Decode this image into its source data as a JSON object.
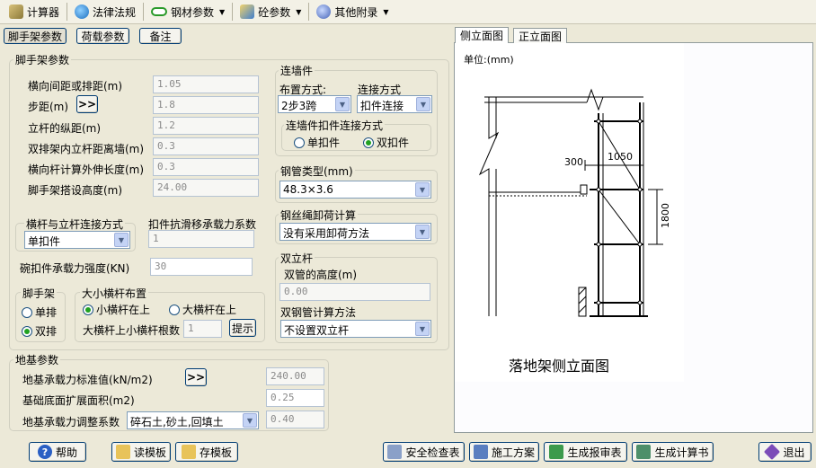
{
  "toolbar": {
    "items": [
      {
        "label": "计算器",
        "icon": "calculator-icon"
      },
      {
        "label": "法律法规",
        "icon": "globe-icon"
      },
      {
        "label": "钢材参数",
        "icon": "steel-icon"
      },
      {
        "label": "砼参数",
        "icon": "concrete-icon"
      },
      {
        "label": "其他附录",
        "icon": "appendix-icon"
      }
    ]
  },
  "top_tabs": {
    "scaffold": "脚手架参数",
    "load": "荷载参数",
    "note": "备注"
  },
  "scaffold": {
    "group_label": "脚手架参数",
    "rows": [
      {
        "label": "横向间距或排距(m)",
        "value": "1.05"
      },
      {
        "label": "步距(m)",
        "value": "1.8"
      },
      {
        "label": "立杆的纵距(m)",
        "value": "1.2"
      },
      {
        "label": "双排架内立杆距离墙(m)",
        "value": "0.3"
      },
      {
        "label": "横向杆计算外伸长度(m)",
        "value": "0.3"
      },
      {
        "label": "脚手架搭设高度(m)",
        "value": "24.00"
      }
    ],
    "step_button": ">>"
  },
  "connection": {
    "group_label": "横杆与立杆连接方式",
    "value": "单扣件",
    "slip_label": "扣件抗滑移承载力系数",
    "slip_value": "1",
    "bowl_label": "碗扣件承载力强度(KN)",
    "bowl_value": "30"
  },
  "frame": {
    "group_label": "脚手架",
    "single": "单排",
    "double": "双排",
    "selected": "double"
  },
  "crossbar": {
    "group_label": "大小横杆布置",
    "small_top": "小横杆在上",
    "big_top": "大横杆在上",
    "selected": "small_top",
    "count_label": "大横杆上小横杆根数",
    "count_value": "1",
    "hint_button": "提示"
  },
  "wall_tie": {
    "group_label": "连墙件",
    "layout_label": "布置方式:",
    "layout_value": "2步3跨",
    "connect_label": "连接方式",
    "connect_value": "扣件连接",
    "clamp_group": "连墙件扣件连接方式",
    "single": "单扣件",
    "double": "双扣件",
    "selected": "double"
  },
  "pipe": {
    "group_label": "钢管类型(mm)",
    "value": "48.3×3.6"
  },
  "wire": {
    "group_label": "钢丝绳卸荷计算",
    "value": "没有采用卸荷方法"
  },
  "double_pole": {
    "group_label": "双立杆",
    "height_label": "双管的高度(m)",
    "height_value": "0.00",
    "method_label": "双钢管计算方法",
    "method_value": "不设置双立杆"
  },
  "foundation": {
    "group_label": "地基参数",
    "standard_label": "地基承载力标准值(kN/m2)",
    "standard_value": "240.00",
    "area_label": "基础底面扩展面积(m2)",
    "area_value": "0.25",
    "adjust_label": "地基承载力调整系数",
    "adjust_select": "碎石土,砂土,回填土",
    "adjust_value": "0.40",
    "more_button": ">>"
  },
  "drawing": {
    "tab_side": "侧立面图",
    "tab_front": "正立面图",
    "unit": "单位:(mm)",
    "dim_300": "300",
    "dim_1050": "1050",
    "dim_1800": "1800",
    "caption": "落地架侧立面图"
  },
  "bottom": {
    "help": "帮助",
    "read_tpl": "读模板",
    "save_tpl": "存模板",
    "safety": "安全检查表",
    "plan": "施工方案",
    "review": "生成报审表",
    "calc": "生成计算书",
    "exit": "退出"
  }
}
